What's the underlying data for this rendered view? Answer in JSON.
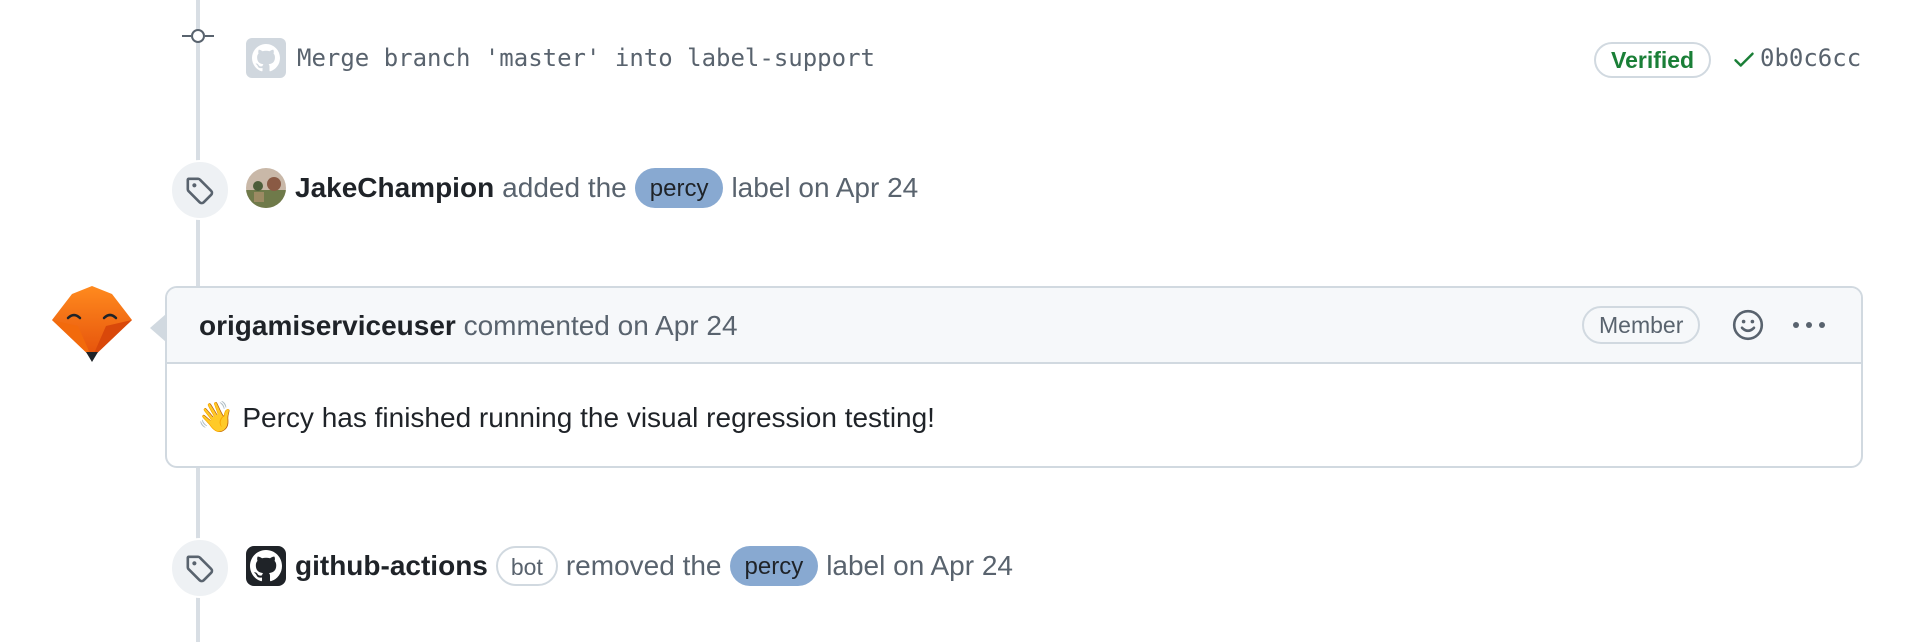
{
  "commit": {
    "message": "Merge branch 'master' into label-support",
    "verified_label": "Verified",
    "sha": "0b0c6cc"
  },
  "label_added_event": {
    "author": "JakeChampion",
    "action": "added the",
    "label_name": "percy",
    "label_color": "#88a9d1",
    "suffix": "label on Apr 24"
  },
  "comment": {
    "author": "origamiserviceuser",
    "meta": "commented on Apr 24",
    "role_badge": "Member",
    "body": "Percy has finished running the visual regression testing!",
    "emoji": "👋"
  },
  "label_removed_event": {
    "author": "github-actions",
    "bot_badge": "bot",
    "action": "removed the",
    "label_name": "percy",
    "label_color": "#88a9d1",
    "suffix": "label on Apr 24"
  },
  "icons": {
    "commit": "git-commit-icon",
    "tag": "tag-icon",
    "check": "check-icon",
    "smiley": "smiley-icon",
    "kebab": "kebab-horizontal-icon",
    "github": "github-mark-icon",
    "fox": "fox-avatar-icon"
  },
  "colors": {
    "verified_green": "#1a7f37",
    "muted_text": "#59636e",
    "border": "#d1d9e0",
    "header_bg": "#f6f8fa"
  }
}
